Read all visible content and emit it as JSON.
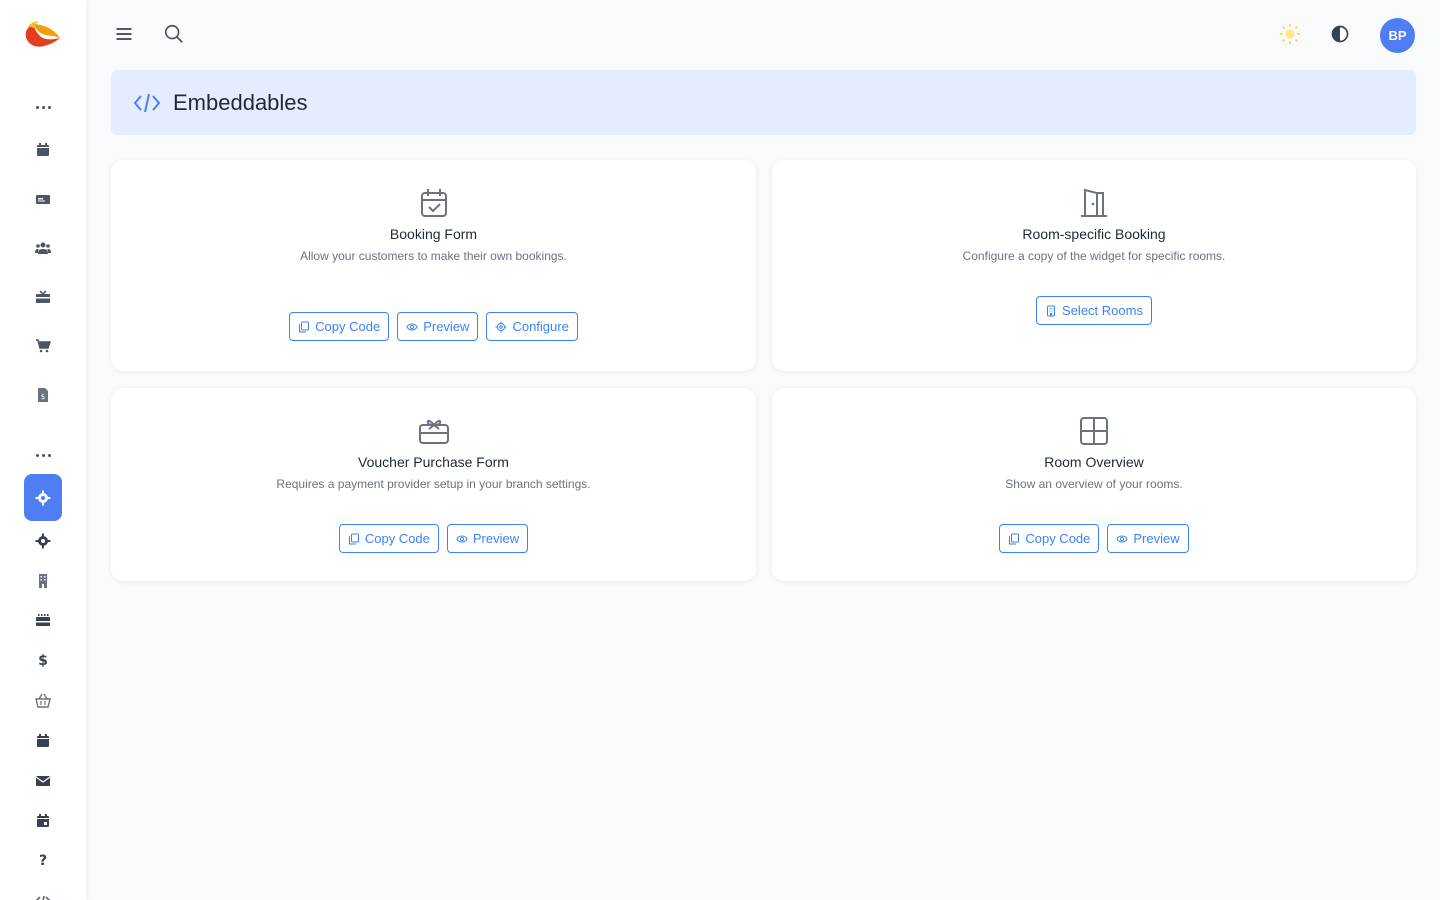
{
  "topbar": {
    "menu_icon": "hamburger-icon",
    "search_icon": "search-icon",
    "theme_icon": "sun-icon",
    "contrast_icon": "contrast-icon",
    "avatar_initials": "BP"
  },
  "sidebar": {
    "items": [
      {
        "icon": "calendar-icon"
      },
      {
        "icon": "id-card-icon"
      },
      {
        "icon": "users-icon"
      },
      {
        "icon": "gift-icon"
      },
      {
        "icon": "cart-icon"
      },
      {
        "icon": "invoice-icon"
      },
      {
        "icon": "gear-icon",
        "active": true
      },
      {
        "icon": "gear-icon"
      },
      {
        "icon": "building-icon"
      },
      {
        "icon": "calendar-grid-icon"
      },
      {
        "icon": "dollar-icon",
        "text": "$"
      },
      {
        "icon": "basket-icon"
      },
      {
        "icon": "calendar-icon"
      },
      {
        "icon": "envelope-icon"
      },
      {
        "icon": "calendar-day-icon"
      },
      {
        "icon": "help-icon",
        "text": "?"
      },
      {
        "icon": "code-icon"
      }
    ]
  },
  "page": {
    "title": "Embeddables",
    "title_icon": "code-icon"
  },
  "cards": [
    {
      "icon": "calendar-check-icon",
      "title": "Booking Form",
      "description": "Allow your customers to make their own bookings.",
      "buttons": [
        "Copy Code",
        "Preview",
        "Configure"
      ]
    },
    {
      "icon": "door-icon",
      "title": "Room-specific Booking",
      "description": "Configure a copy of the widget for specific rooms.",
      "buttons": [
        "Select Rooms"
      ]
    },
    {
      "icon": "gift-card-icon",
      "title": "Voucher Purchase Form",
      "description": "Requires a payment provider setup in your branch settings.",
      "buttons": [
        "Copy Code",
        "Preview"
      ]
    },
    {
      "icon": "grid-icon",
      "title": "Room Overview",
      "description": "Show an overview of your rooms.",
      "buttons": [
        "Copy Code",
        "Preview"
      ]
    }
  ],
  "colors": {
    "accent": "#3b82f6",
    "active_nav": "#4f7df3",
    "banner": "#e3edfd"
  }
}
